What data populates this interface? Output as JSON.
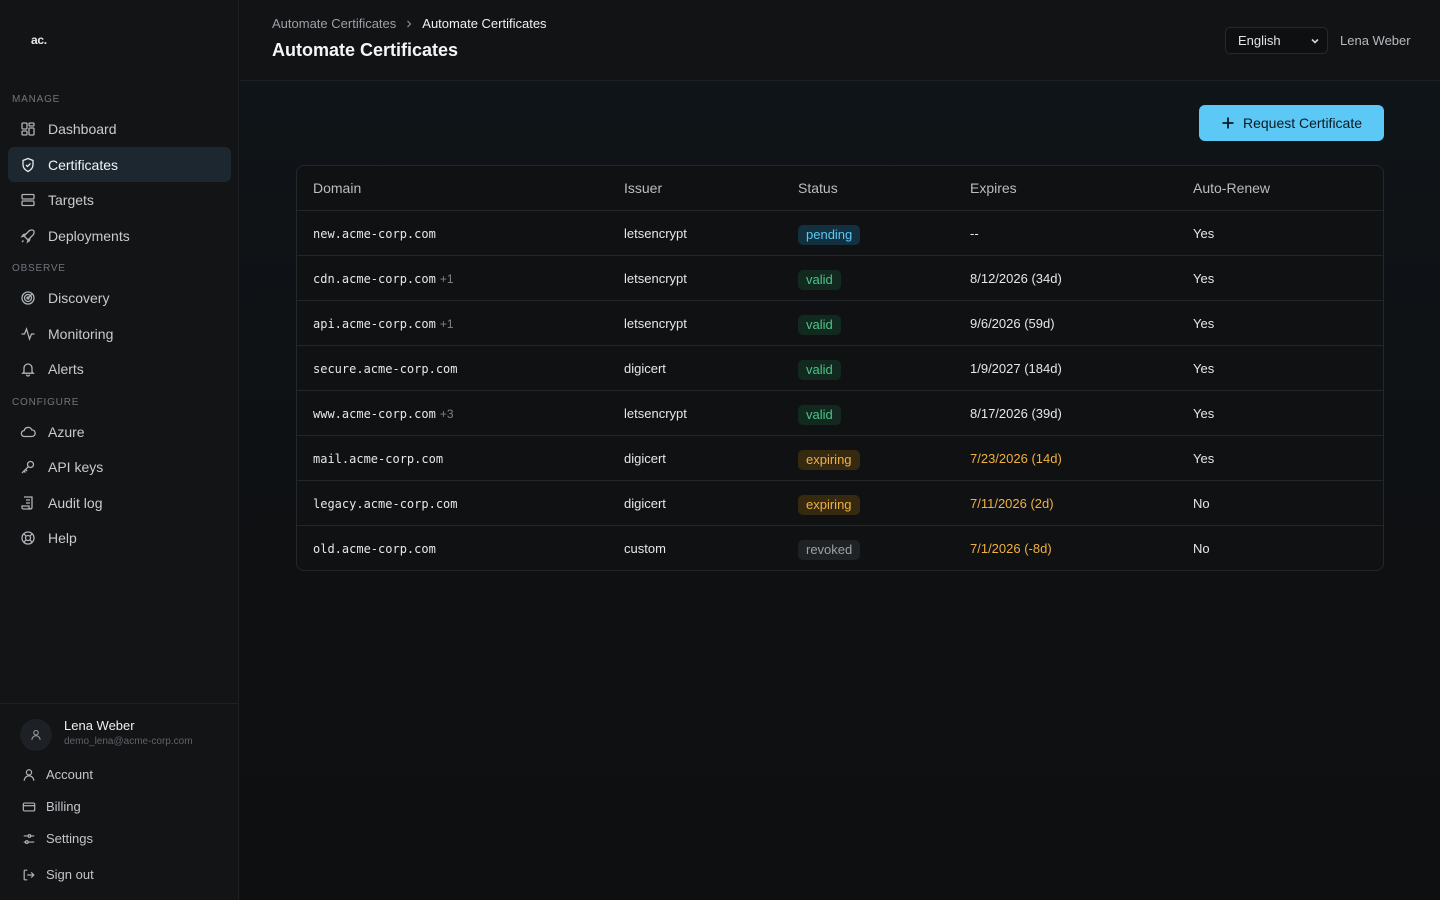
{
  "app": {
    "logo": "ac."
  },
  "sidebar": {
    "sections": [
      {
        "label": "MANAGE",
        "items": [
          {
            "label": "Dashboard",
            "icon": "dashboard-icon"
          },
          {
            "label": "Certificates",
            "icon": "shield-icon",
            "active": true
          },
          {
            "label": "Targets",
            "icon": "server-icon"
          },
          {
            "label": "Deployments",
            "icon": "rocket-icon"
          }
        ]
      },
      {
        "label": "OBSERVE",
        "items": [
          {
            "label": "Discovery",
            "icon": "radar-icon"
          },
          {
            "label": "Monitoring",
            "icon": "activity-icon"
          },
          {
            "label": "Alerts",
            "icon": "bell-icon"
          }
        ]
      },
      {
        "label": "CONFIGURE",
        "items": [
          {
            "label": "Azure",
            "icon": "cloud-icon"
          },
          {
            "label": "API keys",
            "icon": "key-icon"
          },
          {
            "label": "Audit log",
            "icon": "scroll-icon"
          },
          {
            "label": "Help",
            "icon": "lifebuoy-icon"
          }
        ]
      }
    ],
    "user": {
      "name": "Lena Weber",
      "email": "demo_lena@acme-corp.com",
      "links": [
        "Account",
        "Billing",
        "Settings",
        "Sign out"
      ]
    }
  },
  "header": {
    "breadcrumb": [
      "Automate Certificates",
      "Automate Certificates"
    ],
    "title": "Automate Certificates",
    "language": "English",
    "user": "Lena Weber"
  },
  "main": {
    "request_button": "Request Certificate",
    "columns": [
      "Domain",
      "Issuer",
      "Status",
      "Expires",
      "Auto-Renew"
    ],
    "rows": [
      {
        "domain": "new.acme-corp.com",
        "extra": "",
        "issuer": "letsencrypt",
        "status": "pending",
        "expires": "--",
        "auto_renew": "Yes"
      },
      {
        "domain": "cdn.acme-corp.com",
        "extra": "+1",
        "issuer": "letsencrypt",
        "status": "valid",
        "expires": "8/12/2026 (34d)",
        "auto_renew": "Yes"
      },
      {
        "domain": "api.acme-corp.com",
        "extra": "+1",
        "issuer": "letsencrypt",
        "status": "valid",
        "expires": "9/6/2026 (59d)",
        "auto_renew": "Yes"
      },
      {
        "domain": "secure.acme-corp.com",
        "extra": "",
        "issuer": "digicert",
        "status": "valid",
        "expires": "1/9/2027 (184d)",
        "auto_renew": "Yes"
      },
      {
        "domain": "www.acme-corp.com",
        "extra": "+3",
        "issuer": "letsencrypt",
        "status": "valid",
        "expires": "8/17/2026 (39d)",
        "auto_renew": "Yes"
      },
      {
        "domain": "mail.acme-corp.com",
        "extra": "",
        "issuer": "digicert",
        "status": "expiring",
        "expires": "7/23/2026 (14d)",
        "auto_renew": "Yes"
      },
      {
        "domain": "legacy.acme-corp.com",
        "extra": "",
        "issuer": "digicert",
        "status": "expiring",
        "expires": "7/11/2026 (2d)",
        "auto_renew": "No"
      },
      {
        "domain": "old.acme-corp.com",
        "extra": "",
        "issuer": "custom",
        "status": "revoked",
        "expires": "7/1/2026 (-8d)",
        "auto_renew": "No"
      }
    ]
  },
  "colors": {
    "accent": "#5cc8f5",
    "pending": "#5cc8f5",
    "valid": "#4cc38a",
    "expiring": "#f0b042",
    "revoked": "#9aa0a6"
  }
}
